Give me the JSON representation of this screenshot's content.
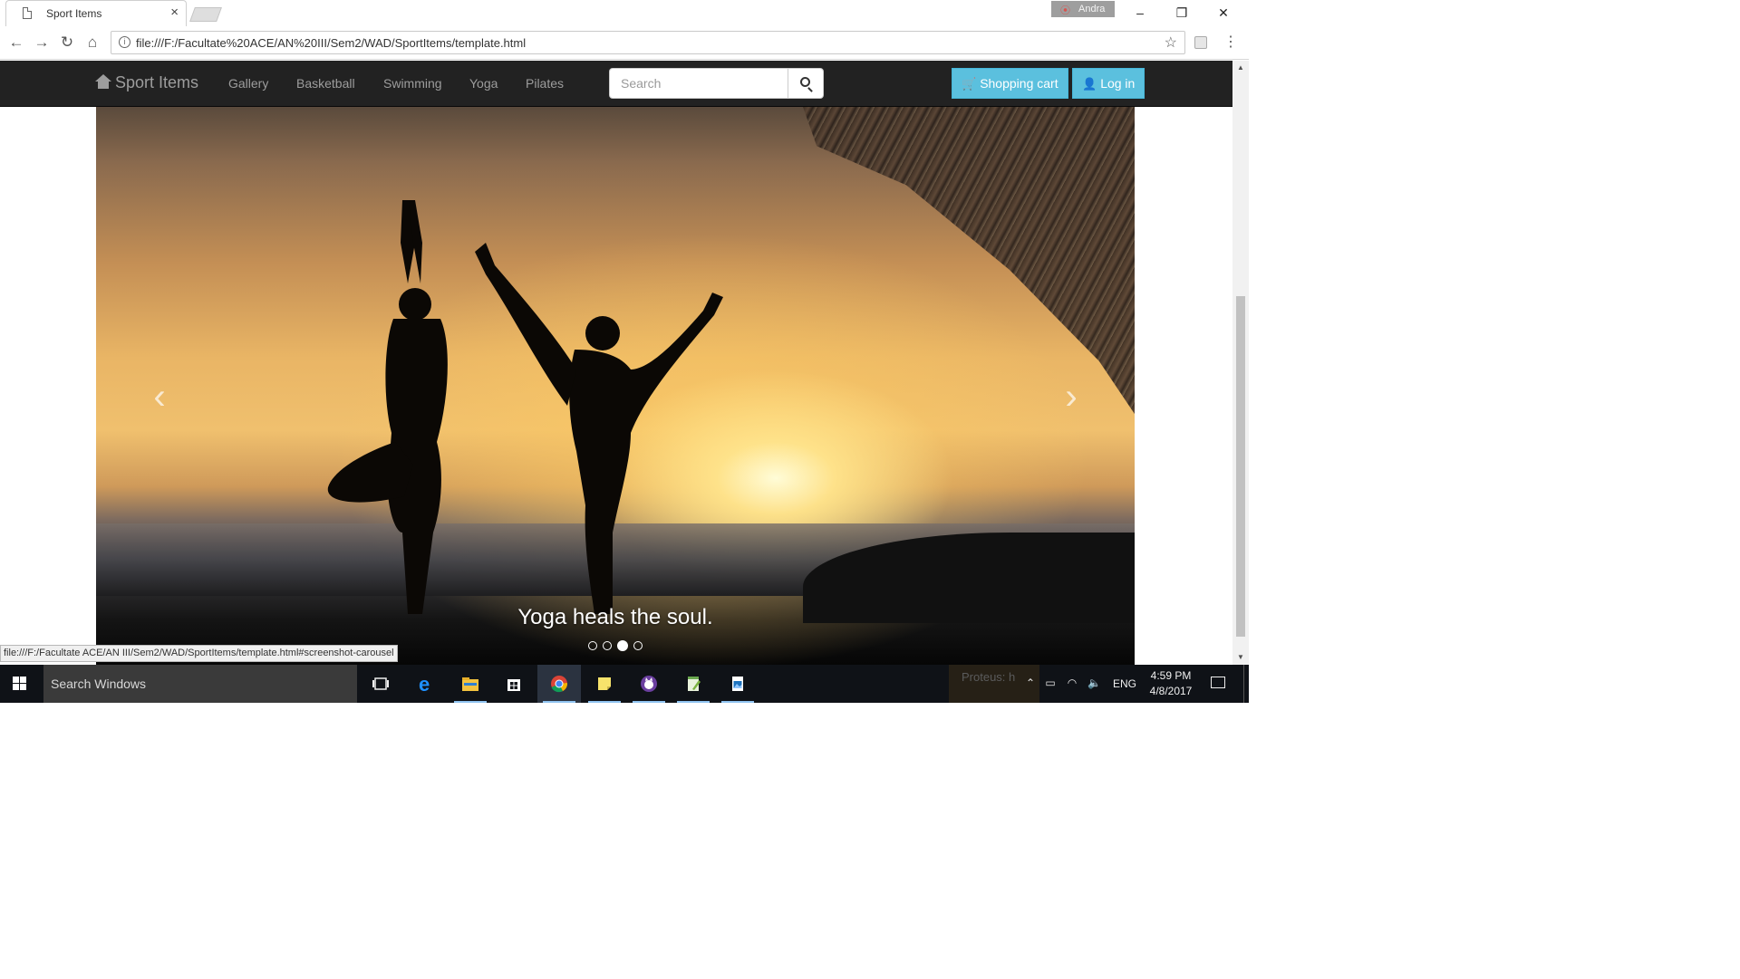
{
  "browser": {
    "tab_title": "Sport Items",
    "tab_close": "×",
    "profile_name": "Andra",
    "window_controls": {
      "minimize": "–",
      "restore": "❐",
      "close": "✕"
    },
    "url": "file:///F:/Facultate%20ACE/AN%20III/Sem2/WAD/SportItems/template.html",
    "status_url": "file:///F:/Facultate ACE/AN III/Sem2/WAD/SportItems/template.html#screenshot-carousel",
    "nav": {
      "back": "←",
      "forward": "→",
      "reload": "↻",
      "home": "⌂"
    },
    "star": "☆",
    "menu": "⋮"
  },
  "site": {
    "brand": "Sport Items",
    "nav_links": [
      "Gallery",
      "Basketball",
      "Swimming",
      "Yoga",
      "Pilates"
    ],
    "search": {
      "placeholder": "Search",
      "value": ""
    },
    "buttons": {
      "cart_icon": "🛒",
      "cart_label": "Shopping cart",
      "login_icon": "👤",
      "login_label": "Log in"
    },
    "carousel": {
      "caption": "Yoga heals the soul.",
      "prev": "‹",
      "next": "›",
      "slide_count": 4,
      "active_index": 2
    }
  },
  "taskbar": {
    "search_placeholder": "Search Windows",
    "tray_popup_text": "Proteus: h",
    "language": "ENG",
    "time": "4:59 PM",
    "date": "4/8/2017"
  },
  "colors": {
    "navbar_bg": "#222222",
    "nav_text": "#9d9d9d",
    "btn_info": "#5bc0de",
    "taskbar_bg": "#0f1217"
  }
}
